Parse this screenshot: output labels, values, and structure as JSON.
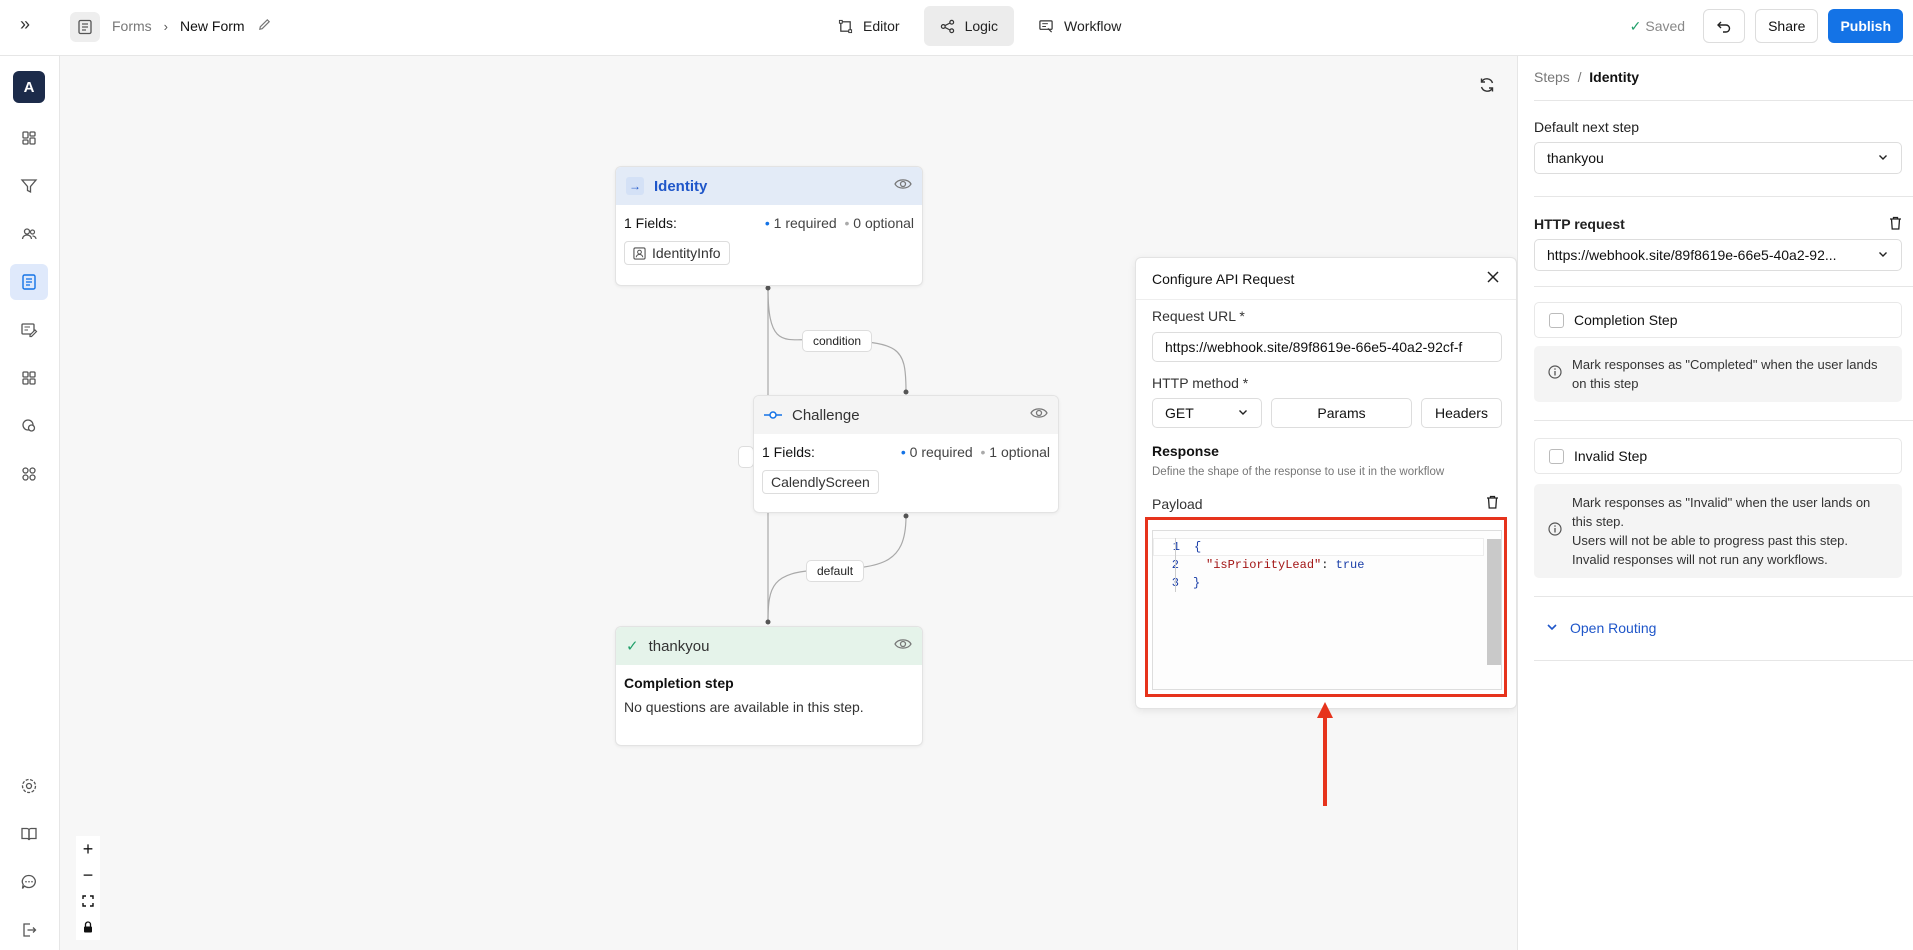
{
  "topbar": {
    "breadcrumb_parent": "Forms",
    "breadcrumb_current": "New Form",
    "tabs": [
      {
        "label": "Editor"
      },
      {
        "label": "Logic"
      },
      {
        "label": "Workflow"
      }
    ],
    "active_tab": "Logic",
    "saved_label": "Saved",
    "share_label": "Share",
    "publish_label": "Publish",
    "accent_color": "#1473e6"
  },
  "sidebar": {
    "avatar_letter": "A",
    "items": [
      "dashboard-icon",
      "filter-icon",
      "users-icon",
      "forms-icon",
      "form-edit-icon",
      "blocks-icon",
      "integrations-icon",
      "apps-icon"
    ],
    "bottom_items": [
      "settings-icon",
      "book-icon",
      "chat-icon",
      "logout-icon"
    ]
  },
  "canvas": {
    "nodes": {
      "identity": {
        "title": "Identity",
        "fields_label": "1 Fields:",
        "required": "1 required",
        "optional": "0 optional",
        "field": "IdentityInfo"
      },
      "challenge": {
        "title": "Challenge",
        "fields_label": "1 Fields:",
        "required": "0 required",
        "optional": "1 optional",
        "field": "CalendlyScreen"
      },
      "thankyou": {
        "title": "thankyou",
        "heading": "Completion step",
        "text": "No questions are available in this step."
      }
    },
    "edges": {
      "condition": "condition",
      "default": "default"
    },
    "zoom": [
      "+",
      "−"
    ]
  },
  "api_popup": {
    "title": "Configure API Request",
    "url_label": "Request URL *",
    "url_value": "https://webhook.site/89f8619e-66e5-40a2-92cf-f",
    "method_label": "HTTP method *",
    "method_value": "GET",
    "params_label": "Params",
    "headers_label": "Headers",
    "response_title": "Response",
    "response_desc": "Define the shape of the response to use it in the workflow",
    "payload_label": "Payload",
    "code": {
      "line1_no": "1",
      "line1": "{",
      "line2_no": "2",
      "line2_key": "\"isPriorityLead\"",
      "line2_colon": ": ",
      "line2_val": "true",
      "line3_no": "3",
      "line3": "}"
    },
    "highlight_color": "#e6331c"
  },
  "right_panel": {
    "crumb_parent": "Steps",
    "crumb_sep": "/",
    "crumb_current": "Identity",
    "default_next_label": "Default next step",
    "default_next_value": "thankyou",
    "http_label": "HTTP request",
    "http_value": "https://webhook.site/89f8619e-66e5-40a2-92...",
    "completion_label": "Completion Step",
    "completion_info": "Mark responses as \"Completed\" when the user lands on this step",
    "invalid_label": "Invalid Step",
    "invalid_info_1": "Mark responses as \"Invalid\" when the user lands on this step.",
    "invalid_info_2": "Users will not be able to progress past this step.",
    "invalid_info_3": "Invalid responses will not run any workflows.",
    "routing_label": "Open Routing"
  }
}
